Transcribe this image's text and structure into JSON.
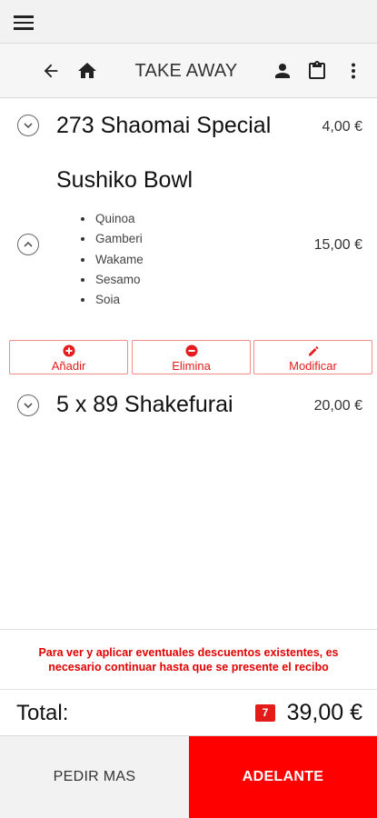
{
  "header": {
    "title": "TAKE AWAY"
  },
  "icons": {
    "menu": "hamburger-menu-icon",
    "back": "arrow-left-icon",
    "home": "home-icon",
    "user": "person-icon",
    "clipboard": "clipboard-icon",
    "more": "more-vertical-icon"
  },
  "order": {
    "items": [
      {
        "name": "273 Shaomai Special",
        "price": "4,00 €",
        "expanded": false
      },
      {
        "name": "Sushiko Bowl",
        "price": "15,00 €",
        "expanded": true,
        "ingredients": [
          "Quinoa",
          "Gamberi",
          "Wakame",
          "Sesamo",
          "Soia"
        ],
        "actions": {
          "add": "Añadir",
          "remove": "Elimina",
          "edit": "Modificar"
        }
      },
      {
        "name": "5 x 89 Shakefurai",
        "price": "20,00 €",
        "expanded": false
      }
    ]
  },
  "notice": {
    "text": "Para ver y aplicar eventuales descuentos existentes, es necesario continuar hasta que se presente el recibo"
  },
  "total": {
    "label": "Total:",
    "badge": "7",
    "value": "39,00 €"
  },
  "footer": {
    "more_label": "PEDIR MAS",
    "next_label": "ADELANTE"
  },
  "colors": {
    "accent": "#ff0000",
    "action_border": "#f28b8b",
    "action_text": "#e61c1c"
  }
}
